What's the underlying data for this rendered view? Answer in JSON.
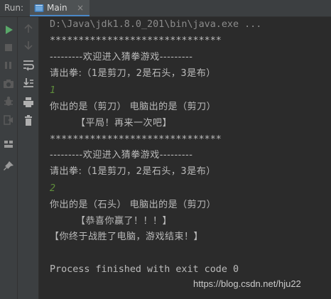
{
  "run_panel": {
    "label": "Run:",
    "tab": {
      "label": "Main",
      "close": "×"
    }
  },
  "toolbar_left": [
    {
      "name": "rerun-icon",
      "color": "#59a869"
    },
    {
      "name": "stop-icon",
      "color": "#6b6b6b"
    },
    {
      "name": "pause-icon",
      "color": "#6b6b6b"
    },
    {
      "name": "camera-icon",
      "color": "#6b6b6b"
    },
    {
      "name": "debug-icon",
      "color": "#6b6b6b"
    },
    {
      "name": "exit-icon",
      "color": "#6b6b6b"
    },
    {
      "name": "layout-icon",
      "color": "#9a9a9a"
    },
    {
      "name": "pin-icon",
      "color": "#9a9a9a"
    }
  ],
  "toolbar_right": [
    {
      "name": "arrow-up-icon"
    },
    {
      "name": "arrow-down-icon"
    },
    {
      "name": "soft-wrap-icon"
    },
    {
      "name": "scroll-to-end-icon"
    },
    {
      "name": "print-icon"
    },
    {
      "name": "trash-icon"
    }
  ],
  "console": {
    "lines": [
      "D:\\Java\\jdk1.8.0_201\\bin\\java.exe ...",
      "******************************",
      "---------欢迎进入猜拳游戏---------",
      "请出拳:（1是剪刀，2是石头，3是布）",
      "1",
      "你出的是（剪刀） 电脑出的是（剪刀）",
      "        【平局！再来一次吧】",
      "******************************",
      "---------欢迎进入猜拳游戏---------",
      "请出拳:（1是剪刀，2是石头，3是布）",
      "2",
      "你出的是（石头） 电脑出的是（剪刀）",
      "        【恭喜你赢了！！！】",
      "【你终于战胜了电脑，游戏结束！】",
      "",
      "Process finished with exit code 0"
    ]
  },
  "watermark": "https://blog.csdn.net/hju22",
  "colors": {
    "background": "#2b2b2b",
    "text": "#bbbbbb",
    "command": "#8c8c8c",
    "user_input": "#5e8c3b",
    "accent": "#4a88c7"
  }
}
